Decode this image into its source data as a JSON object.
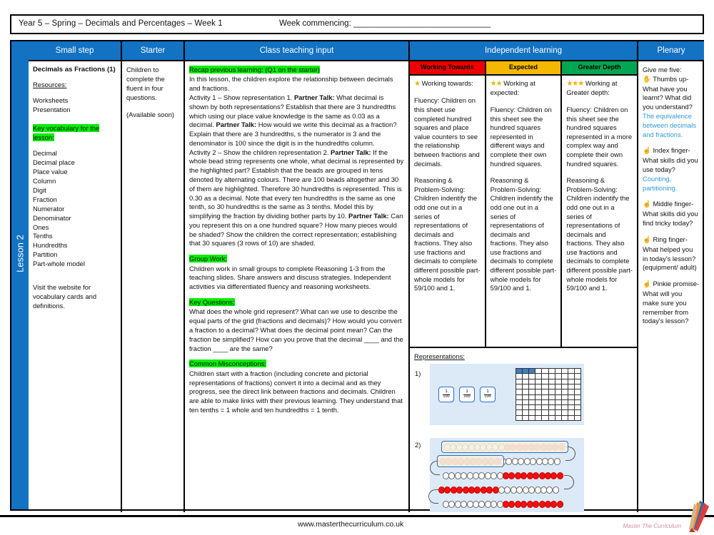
{
  "header": {
    "title": "Year 5 – Spring – Decimals and Percentages – Week 1",
    "week_commencing": "Week commencing: ______________________________"
  },
  "spine": {
    "lesson_label": "Lesson 2"
  },
  "columns": {
    "small_step": "Small step",
    "starter": "Starter",
    "teaching": "Class teaching input",
    "independent": "Independent learning",
    "plenary": "Plenary"
  },
  "small_step": {
    "title": "Decimals as Fractions (1)",
    "resources_heading": "Resources:",
    "resources": [
      "Worksheets",
      "Presentation"
    ],
    "vocab_heading": "Key vocabulary for the lesson:",
    "vocabulary": [
      "Decimal",
      "Decimal place",
      "Place value",
      "Column",
      "Digit",
      "Fraction",
      "Numerator",
      "Denominator",
      "Ones",
      "Tenths",
      "Hundredths",
      "Partition",
      "Part-whole model"
    ],
    "footer_note": "Visit the website for vocabulary cards and definitions."
  },
  "starter": {
    "paragraph": "Children to complete the fluent in four questions.",
    "availability": "(Available soon)"
  },
  "teaching": {
    "recap_heading": "Recap previous learning: (Q1 on the starter)",
    "intro": "In this lesson, the children explore the relationship between decimals and fractions.",
    "activity1_pre": "Activity 1 – Show representation 1. ",
    "activity1_bold1": "Partner Talk:",
    "activity1_mid1": " What decimal is shown by both representations? Establish that there are 3 hundredths which using our place value knowledge is the same as 0.03 as a decimal. ",
    "activity1_bold2": "Partner Talk:",
    "activity1_mid2": " How would we write this decimal as a fraction? Explain that there are 3 hundredths, s the numerator is 3 and the denominator is 100 since the digit is in the hundredths column.",
    "activity2_pre": "Activity 2 – Show the children representation 2. ",
    "activity2_bold1": "Partner Talk:",
    "activity2_mid1": " If the whole bead string represents one whole, what decimal is represented by the highlighted part? Establish that the beads are grouped in tens denoted by alternating colours. There are 100 beads altogether and 30 of them are highlighted. Therefore 30 hundredths is represented. This is 0.30 as a decimal. Note that every ten hundredths is the same as one tenth, so 30 hundredths is the same as 3 tenths. Model this by simplifying the fraction by dividing bother parts by 10. ",
    "activity2_bold2": "Partner Talk:",
    "activity2_mid2": " Can you represent this on a one hundred square? How many pieces would be shaded? Show the children the correct representation; establishing that 30 squares (3 rows of 10) are shaded.",
    "group_work_heading": "Group Work:",
    "group_work": "Children work in small groups to complete Reasoning 1-3 from the teaching slides. Share answers and discuss strategies. Independent activities via differentiated fluency and reasoning worksheets.",
    "key_questions_heading": "Key Questions:",
    "key_questions": "What does the whole grid represent? What can we use to describe the equal parts of the grid (fractions and decimals)? How would you convert a fraction to a decimal? What does the decimal point mean? Can the fraction be simplified? How can you prove that the decimal ____ and the fraction ____ are the same?",
    "misconceptions_heading": "Common Misconceptions:",
    "misconceptions": "Children start with a fraction (including concrete and pictorial representations of fractions) convert it into a decimal and as they progress, see the direct link between fractions and decimals. Children are able to make links with their previous learning. They understand that ten tenths = 1 whole and ten hundredths = 1 tenth."
  },
  "independent": {
    "levels": [
      {
        "label": "Working Towards",
        "header_color": "#ee0000",
        "stars": "★",
        "intro": " Working towards:",
        "fluency": "Fluency: Children on this sheet use completed hundred squares and place value counters to see the relationship between fractions and decimals.",
        "reasoning": "Reasoning & Problem-Solving: Children indentify the odd one out in a series of representations of decimals and fractions. They also use fractions and decimals to complete different possible part-whole models for 59/100 and 1."
      },
      {
        "label": "Expected",
        "header_color": "#f5b800",
        "stars": "★★",
        "intro": " Working at expected:",
        "fluency": "Fluency: Children on this sheet see the hundred squares represented in different ways and complete their own hundred squares.",
        "reasoning": "Reasoning & Problem-Solving: Children indentify the odd one out in a series of representations of decimals and fractions. They also use fractions and decimals to complete different possible part-whole models for 59/100 and 1."
      },
      {
        "label": "Greater Depth",
        "header_color": "#00a651",
        "stars": "★★★",
        "intro": " Working at Greater depth:",
        "fluency": "Fluency: Children on this sheet see the hundred squares represented in a more complex way and complete their own hundred squares.",
        "reasoning": "Reasoning & Problem-Solving: Children indentify the odd one out in a series of representations of decimals and fractions. They also use fractions and decimals to complete different possible part-whole models for 59/100 and 1."
      }
    ],
    "representations_heading": "Representations:",
    "rep1_number": "1)",
    "rep2_number": "2)",
    "counter_numerator": "1",
    "counter_denominator": "100",
    "hundred_square_shaded": 3,
    "bead_string_rows": 5,
    "beads_per_row": 20
  },
  "plenary": {
    "intro": "Give me five:",
    "items": [
      {
        "hand": "✋",
        "question": "Thumbs up- What have you learnt? What did you understand?",
        "answer": "The equivalence between decimals and fractions."
      },
      {
        "hand": "☝",
        "question": "Index finger- What skills did you use today?",
        "answer": "Counting, partitioning."
      },
      {
        "hand": "☝",
        "question": "Middle finger- What skills did you find tricky today?",
        "answer": ""
      },
      {
        "hand": "☝",
        "question": "Ring finger- What helped you in today's lesson? (equipment/ adult)",
        "answer": ""
      },
      {
        "hand": "☝",
        "question": "Pinkie promise- What will you make sure you remember from today's lesson?",
        "answer": ""
      }
    ]
  },
  "footer": {
    "url": "www.masterthecurriculum.co.uk",
    "logo_text": "Master The Curriculum"
  },
  "colors": {
    "brand_blue": "#1372c2",
    "highlight_green": "#00ee00",
    "answer_blue": "#2e9bd6",
    "rep_bg": "#dce9f7"
  }
}
